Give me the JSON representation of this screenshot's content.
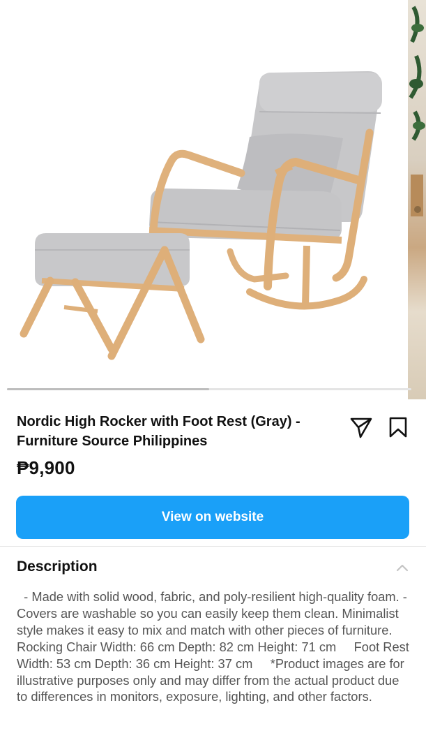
{
  "product": {
    "title": "Nordic High Rocker with Foot Rest (Gray) - Furniture Source Philippines",
    "price": "₱9,900",
    "gallery_progress_fraction": 0.5
  },
  "actions": {
    "view_label": "View on website",
    "share_icon": "paper-plane-icon",
    "save_icon": "bookmark-icon"
  },
  "description": {
    "header": "Description",
    "collapse_icon": "chevron-up-icon",
    "body": "  - Made with solid wood, fabric, and poly-resilient high-quality foam. - Covers are washable so you can easily keep them clean. Minimalist style makes it easy to mix and match with other pieces of furniture.     Rocking Chair Width: 66 cm Depth: 82 cm Height: 71 cm     Foot Rest Width: 53 cm Depth: 36 cm Height: 37 cm     *Product images are for illustrative purposes only and may differ from the actual product due to differences in monitors, exposure, lighting, and other factors."
  },
  "colors": {
    "accent": "#1aa0f8",
    "upholstery": "#c9c9cb",
    "wood": "#e0b27e"
  }
}
